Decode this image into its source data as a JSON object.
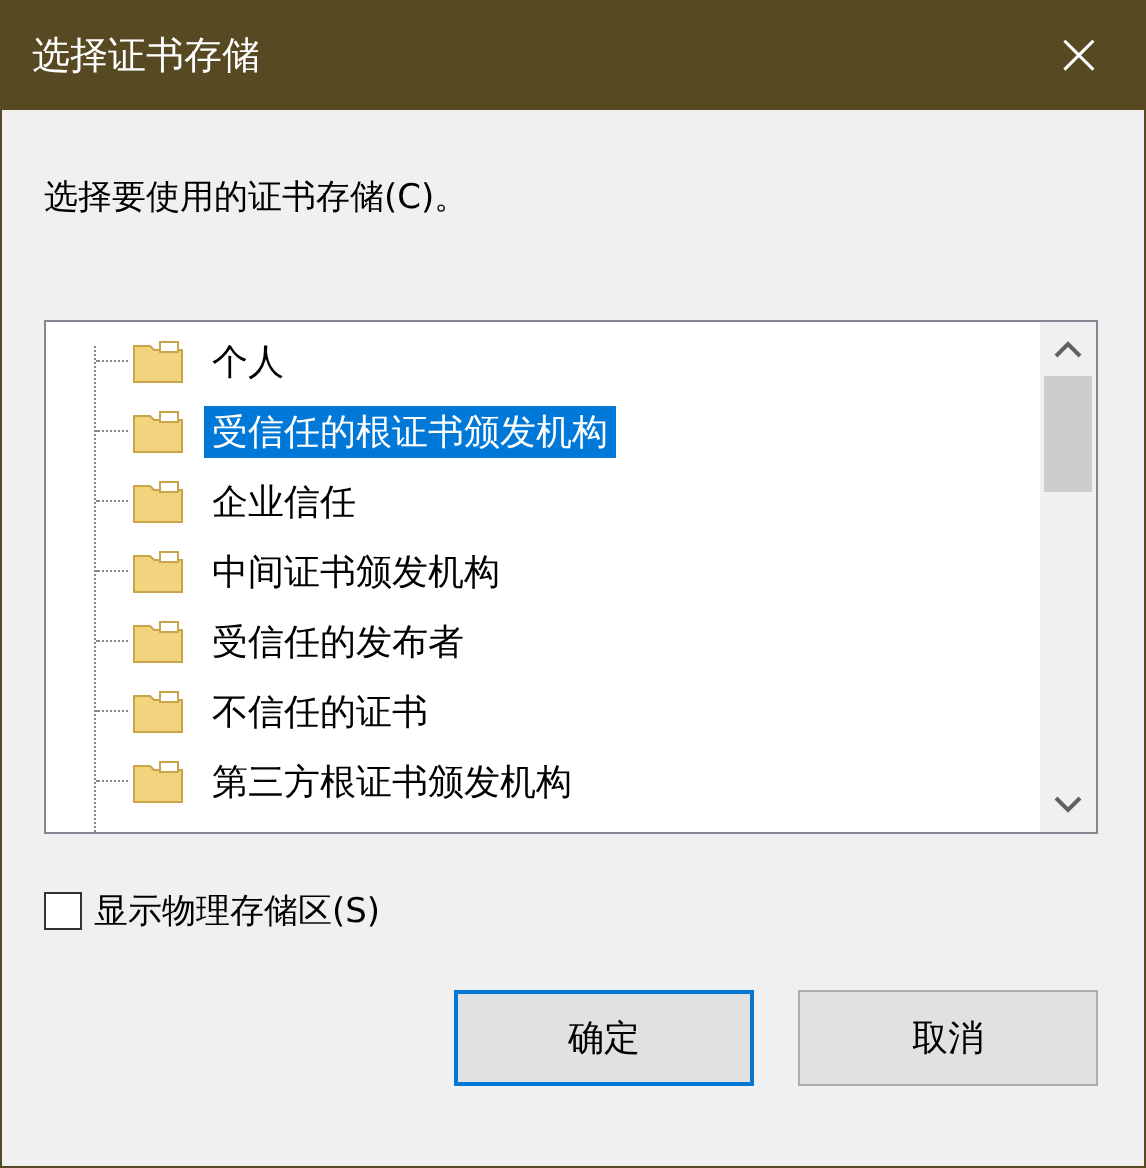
{
  "window": {
    "title": "选择证书存储",
    "close": "×"
  },
  "instruction": "选择要使用的证书存储(C)。",
  "tree": {
    "items": [
      {
        "label": "个人",
        "selected": false
      },
      {
        "label": "受信任的根证书颁发机构",
        "selected": true
      },
      {
        "label": "企业信任",
        "selected": false
      },
      {
        "label": "中间证书颁发机构",
        "selected": false
      },
      {
        "label": "受信任的发布者",
        "selected": false
      },
      {
        "label": "不信任的证书",
        "selected": false
      },
      {
        "label": "第三方根证书颁发机构",
        "selected": false
      }
    ]
  },
  "show_physical": {
    "label": "显示物理存储区(S)",
    "checked": false
  },
  "buttons": [
    {
      "label": "确定",
      "default": true
    },
    {
      "label": "取消",
      "default": false
    }
  ]
}
